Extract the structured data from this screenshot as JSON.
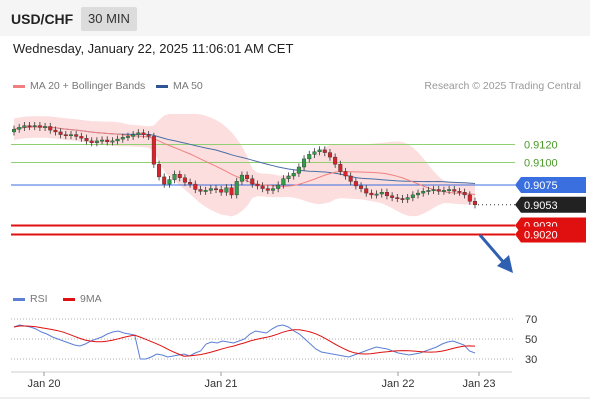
{
  "header": {
    "symbol": "USD/CHF",
    "timeframe": "30 MIN",
    "datetime": "Wednesday, January 22, 2025 11:06:01 AM CET"
  },
  "legend": {
    "ma20_label": "MA 20 + Bollinger Bands",
    "ma50_label": "MA 50",
    "credit": "Research © 2025 Trading Central",
    "rsi_label": "RSI",
    "ma9_label": "9MA"
  },
  "colors": {
    "candle_up": "#2e9e48",
    "candle_down": "#d8232a",
    "bollinger_fill": "#fbd8d8",
    "ma20": "#f08080",
    "ma50": "#4a6fa5",
    "pivot_line": "#3a6fe0",
    "support": "#e01010",
    "resistance": "#90d070",
    "rsi": "#5b7fd6",
    "rsi_ma": "#e01010",
    "arrow": "#2f5fb0"
  },
  "chart_data": {
    "type": "candlestick",
    "x_ticks": [
      "Jan 20",
      "Jan 21",
      "Jan 22",
      "Jan 23"
    ],
    "price_levels": [
      {
        "value": 0.912,
        "label": "0.9120",
        "kind": "resistance"
      },
      {
        "value": 0.91,
        "label": "0.9100",
        "kind": "resistance"
      },
      {
        "value": 0.9075,
        "label": "0.9075",
        "kind": "pivot"
      },
      {
        "value": 0.9053,
        "label": "0.9053",
        "kind": "last_price"
      },
      {
        "value": 0.903,
        "label": "0.9030",
        "kind": "support"
      },
      {
        "value": 0.902,
        "label": "0.9020",
        "kind": "support"
      }
    ],
    "price_range": [
      0.9005,
      0.9165
    ],
    "candles_close": [
      0.9137,
      0.9139,
      0.9141,
      0.914,
      0.9141,
      0.9139,
      0.914,
      0.9136,
      0.9134,
      0.9131,
      0.913,
      0.9131,
      0.9129,
      0.9127,
      0.9124,
      0.9122,
      0.9124,
      0.9125,
      0.9123,
      0.9124,
      0.9126,
      0.9128,
      0.9129,
      0.9131,
      0.9133,
      0.9131,
      0.9129,
      0.9098,
      0.9084,
      0.9076,
      0.9081,
      0.9087,
      0.9083,
      0.9078,
      0.9076,
      0.907,
      0.9068,
      0.9069,
      0.9071,
      0.907,
      0.9067,
      0.9072,
      0.9064,
      0.9079,
      0.9086,
      0.9082,
      0.9076,
      0.9074,
      0.9071,
      0.9069,
      0.9071,
      0.9075,
      0.9082,
      0.9085,
      0.9088,
      0.9095,
      0.9104,
      0.9109,
      0.9112,
      0.9114,
      0.9111,
      0.9106,
      0.9098,
      0.909,
      0.9085,
      0.9079,
      0.9074,
      0.9071,
      0.9066,
      0.9064,
      0.9065,
      0.9067,
      0.9063,
      0.9061,
      0.906,
      0.9059,
      0.9061,
      0.9064,
      0.9066,
      0.9068,
      0.9069,
      0.907,
      0.9068,
      0.9069,
      0.907,
      0.9068,
      0.9067,
      0.9064,
      0.9057,
      0.9053
    ],
    "rsi_range": [
      25,
      75
    ],
    "rsi_ticks": [
      70,
      50,
      30
    ],
    "rsi": [
      62,
      64,
      63,
      62,
      60,
      57,
      55,
      52,
      50,
      48,
      46,
      44,
      43,
      45,
      48,
      50,
      52,
      55,
      57,
      58,
      56,
      55,
      54,
      30,
      30,
      32,
      35,
      34,
      32,
      33,
      34,
      35,
      33,
      36,
      38,
      45,
      47,
      46,
      48,
      47,
      46,
      48,
      50,
      55,
      58,
      57,
      56,
      60,
      63,
      64,
      62,
      58,
      55,
      50,
      45,
      40,
      37,
      36,
      35,
      34,
      33,
      32,
      34,
      36,
      38,
      40,
      42,
      41,
      40,
      38,
      36,
      35,
      34,
      35,
      36,
      38,
      40,
      42,
      45,
      47,
      48,
      46,
      44,
      38,
      36
    ]
  }
}
